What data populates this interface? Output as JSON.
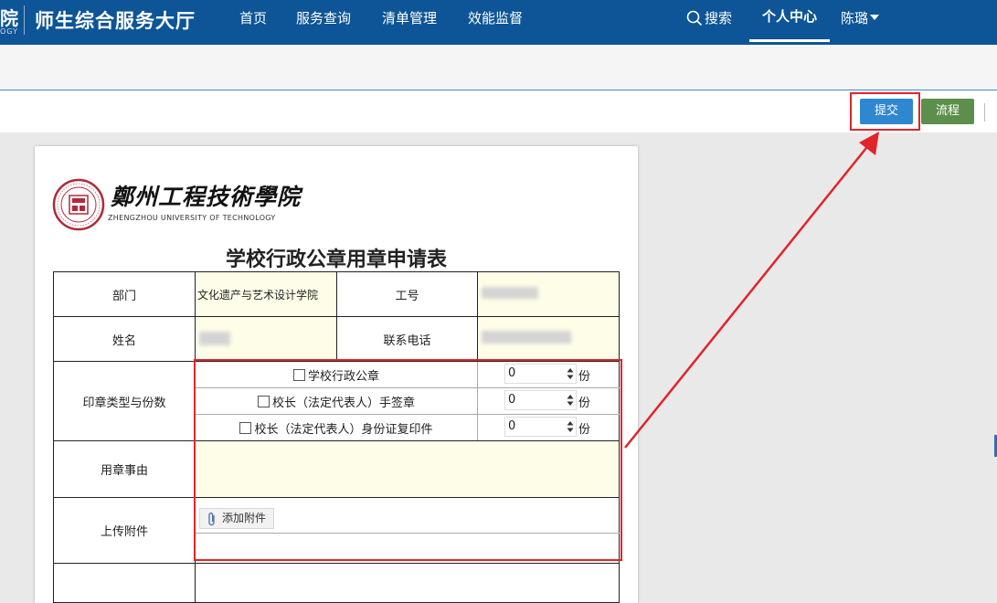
{
  "header": {
    "logo_char": "院",
    "logo_sub": "OGY",
    "app_title": "师生综合服务大厅",
    "nav": [
      "首页",
      "服务查询",
      "清单管理",
      "效能监督"
    ],
    "search_label": "搜索",
    "personal_center": "个人中心",
    "user_name": "陈璐"
  },
  "toolbar": {
    "submit_label": "提交",
    "flow_label": "流程"
  },
  "form": {
    "school_name": "鄭州工程技術學院",
    "school_en": "ZHENGZHOU UNIVERSITY OF TECHNOLOGY",
    "title": "学校行政公章用章申请表",
    "dept_label": "部门",
    "dept_value": "文化遗产与艺术设计学院",
    "job_no_label": "工号",
    "name_label": "姓名",
    "phone_label": "联系电话",
    "seal_type_label": "印章类型与份数",
    "seal_options": [
      {
        "label": "学校行政公章",
        "count": "0",
        "unit": "份"
      },
      {
        "label": "校长（法定代表人）手签章",
        "count": "0",
        "unit": "份"
      },
      {
        "label": "校长（法定代表人）身份证复印件",
        "count": "0",
        "unit": "份"
      }
    ],
    "reason_label": "用章事由",
    "upload_label": "上传附件",
    "add_attachment": "添加附件"
  }
}
